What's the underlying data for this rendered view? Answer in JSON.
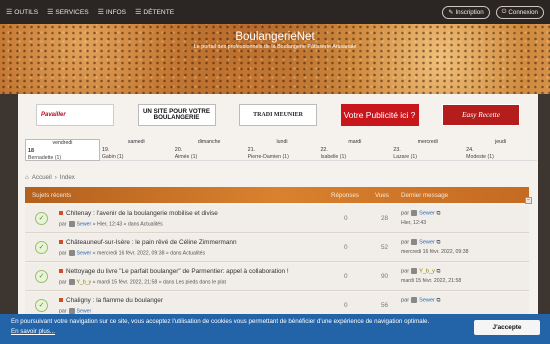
{
  "nav": {
    "items": [
      {
        "label": "OUTILS",
        "icon": "menu-icon"
      },
      {
        "label": "SERVICES",
        "icon": "menu-icon"
      },
      {
        "label": "INFOS",
        "icon": "menu-icon"
      },
      {
        "label": "DÉTENTE",
        "icon": "menu-icon"
      }
    ],
    "register": "Inscription",
    "login": "Connexion"
  },
  "site": {
    "title": "BoulangerieNet",
    "subtitle": "Le portail des professionnels de la Boulangerie Pâtisserie Artisanale"
  },
  "ads": [
    {
      "text": "Pavailler"
    },
    {
      "text": "UN SITE POUR VOTRE BOULANGERIE"
    },
    {
      "text": "TRADI MEUNIER"
    },
    {
      "text": "Votre Publicité ici ?"
    },
    {
      "text": "Easy Recette"
    }
  ],
  "calendar": [
    {
      "day": "vendredi",
      "num": "18",
      "who": "Bernadette (1)",
      "today": true
    },
    {
      "day": "samedi",
      "num": "19.",
      "who": "Gabin (1)"
    },
    {
      "day": "dimanche",
      "num": "20.",
      "who": "Aimée (1)"
    },
    {
      "day": "lundi",
      "num": "21.",
      "who": "Pierre-Damien (1)"
    },
    {
      "day": "mardi",
      "num": "22.",
      "who": "Isabelle (1)"
    },
    {
      "day": "mercredi",
      "num": "23.",
      "who": "Lazare (1)"
    },
    {
      "day": "jeudi",
      "num": "24.",
      "who": "Modeste (1)"
    }
  ],
  "breadcrumb": {
    "home": "Accueil",
    "sep": "›",
    "current": "Index"
  },
  "forum": {
    "heading": "Sujets récents",
    "col_replies": "Réponses",
    "col_views": "Vues",
    "col_last": "Dernier message",
    "topics": [
      {
        "title": "Chitenay : l'avenir de la boulangerie mobilise et divise",
        "meta_prefix": "par",
        "author": "Sewer",
        "meta_suffix": "» Hier, 12:43 » dans Actualités",
        "replies": "0",
        "views": "28",
        "last_by": "par",
        "last_user": "Sewer",
        "last_when": "Hier, 12:43",
        "gold": false
      },
      {
        "title": "Châteauneuf-sur-Isère : le pain rêvé de Céline Zimmermann",
        "meta_prefix": "par",
        "author": "Sewer",
        "meta_suffix": "» mercredi 16 févr. 2022, 09:38 » dans Actualités",
        "replies": "0",
        "views": "52",
        "last_by": "par",
        "last_user": "Sewer",
        "last_when": "mercredi 16 févr. 2022, 09:38",
        "gold": false
      },
      {
        "title": "Nettoyage du livre \"Le parfait boulanger\" de Parmentier: appel à collaboration !",
        "meta_prefix": "par",
        "author": "Y_b_y",
        "meta_suffix": "» mardi 15 févr. 2022, 21:58 » dans Les pieds dans le plat",
        "replies": "0",
        "views": "90",
        "last_by": "par",
        "last_user": "Y_b_y",
        "last_when": "mardi 15 févr. 2022, 21:58",
        "gold": true
      },
      {
        "title": "Chaligny : la flamme du boulanger",
        "meta_prefix": "par",
        "author": "Sewer",
        "meta_suffix": "",
        "replies": "0",
        "views": "56",
        "last_by": "par",
        "last_user": "Sewer",
        "last_when": "",
        "gold": false
      }
    ]
  },
  "cookie": {
    "message": "En poursuivant votre navigation sur ce site, vous acceptez l'utilisation de cookies vous permettant de bénéficier d'une expérience de navigation optimale.",
    "more": "En savoir plus...",
    "accept": "J'accepte"
  }
}
